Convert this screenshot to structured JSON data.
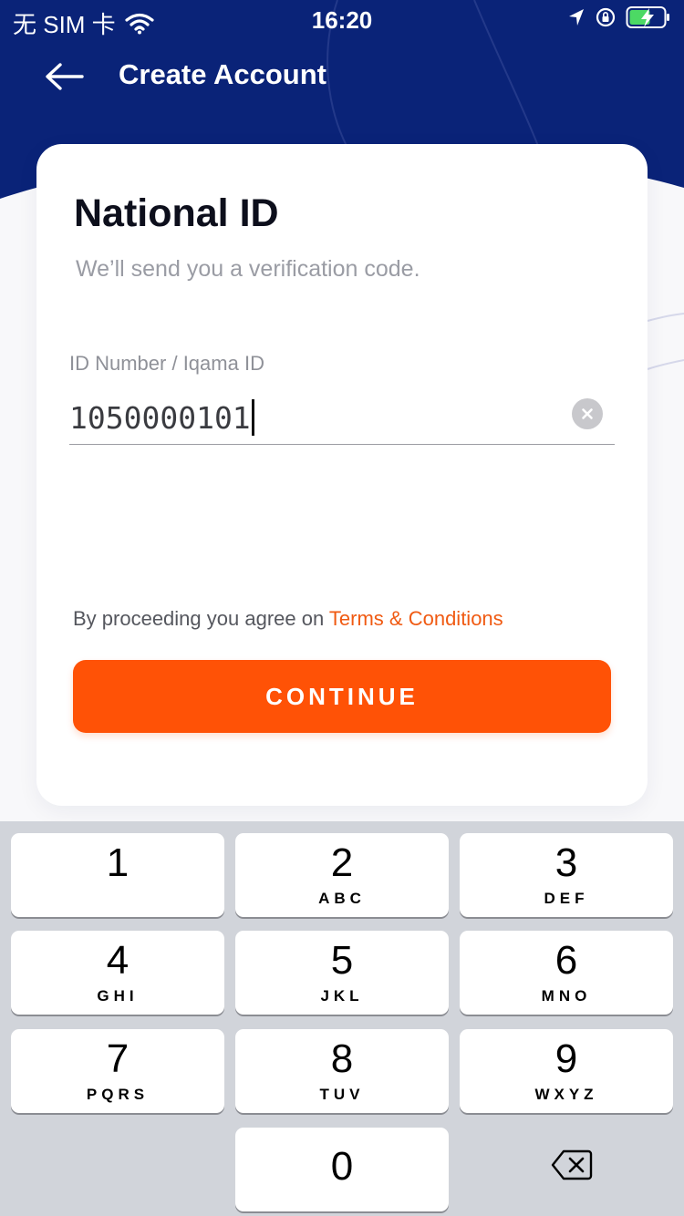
{
  "status_bar": {
    "carrier": "无 SIM 卡",
    "time": "16:20"
  },
  "nav": {
    "title": "Create Account"
  },
  "card": {
    "title": "National ID",
    "subtitle": "We’ll send you a verification code.",
    "field": {
      "label": "ID Number / Iqama ID",
      "value": "1050000101"
    },
    "terms_prefix": "By proceeding you agree on ",
    "terms_link": "Terms & Conditions",
    "continue_label": "CONTINUE"
  },
  "keyboard": {
    "keys": [
      {
        "digit": "1",
        "letters": ""
      },
      {
        "digit": "2",
        "letters": "ABC"
      },
      {
        "digit": "3",
        "letters": "DEF"
      },
      {
        "digit": "4",
        "letters": "GHI"
      },
      {
        "digit": "5",
        "letters": "JKL"
      },
      {
        "digit": "6",
        "letters": "MNO"
      },
      {
        "digit": "7",
        "letters": "PQRS"
      },
      {
        "digit": "8",
        "letters": "TUV"
      },
      {
        "digit": "9",
        "letters": "WXYZ"
      },
      {
        "digit": "0",
        "letters": ""
      }
    ]
  },
  "colors": {
    "header": "#0a2378",
    "accent": "#ff5206",
    "link": "#f05a12",
    "battery": "#4cd964"
  },
  "icons": [
    "wifi-icon",
    "location-arrow-icon",
    "orientation-lock-icon",
    "battery-charging-icon",
    "back-arrow-icon",
    "clear-icon",
    "delete-key-icon"
  ]
}
